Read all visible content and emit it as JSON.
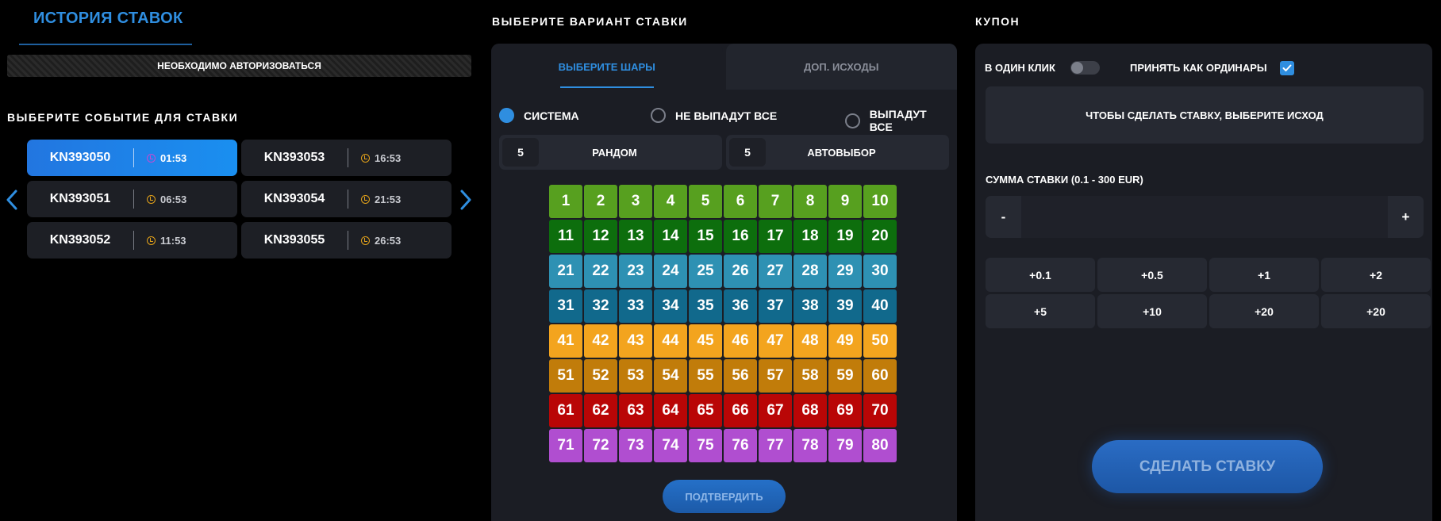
{
  "history": {
    "title": "ИСТОРИЯ СТАВОК",
    "auth_notice": "НЕОБХОДИМО АВТОРИЗОВАТЬСЯ"
  },
  "events": {
    "title": "ВЫБЕРИТЕ СОБЫТИЕ ДЛЯ СТАВКИ",
    "items": [
      {
        "id": "KN393050",
        "time": "01:53",
        "active": true
      },
      {
        "id": "KN393053",
        "time": "16:53",
        "active": false
      },
      {
        "id": "KN393051",
        "time": "06:53",
        "active": false
      },
      {
        "id": "KN393054",
        "time": "21:53",
        "active": false
      },
      {
        "id": "KN393052",
        "time": "11:53",
        "active": false
      },
      {
        "id": "KN393055",
        "time": "26:53",
        "active": false
      }
    ]
  },
  "bet": {
    "title": "ВЫБЕРИТЕ ВАРИАНТ СТАВКИ",
    "tabs": [
      "ВЫБЕРИТЕ ШАРЫ",
      "ДОП. ИСХОДЫ"
    ],
    "radios": [
      "СИСТЕМА",
      "НЕ ВЫПАДУТ ВСЕ",
      "ВЫПАДУТ ВСЕ"
    ],
    "random": {
      "count": "5",
      "label": "РАНДОМ"
    },
    "autoselect": {
      "count": "5",
      "label": "АВТОВЫБОР"
    },
    "row_colors": [
      "#57a01f",
      "#0d6e0d",
      "#2e91b3",
      "#11698c",
      "#f3a41e",
      "#c17c0a",
      "#b90606",
      "#b04ed0"
    ],
    "confirm": "ПОДТВЕРДИТЬ"
  },
  "coupon": {
    "title": "КУПОН",
    "one_click": "В ОДИН КЛИК",
    "accept_singles": "ПРИНЯТЬ КАК ОРДИНАРЫ",
    "message": "ЧТОБЫ СДЕЛАТЬ СТАВКУ, ВЫБЕРИТЕ ИСХОД",
    "sum_label": "СУММА СТАВКИ (0.1 - 300 EUR)",
    "minus": "-",
    "plus": "+",
    "quick": [
      "+0.1",
      "+0.5",
      "+1",
      "+2",
      "+5",
      "+10",
      "+20",
      "+20"
    ],
    "make_bet": "СДЕЛАТЬ СТАВКУ"
  },
  "icons": {
    "clock": "clock-icon",
    "arrows": [
      "chevron-left-icon",
      "chevron-right-icon"
    ],
    "check": "check-icon"
  }
}
